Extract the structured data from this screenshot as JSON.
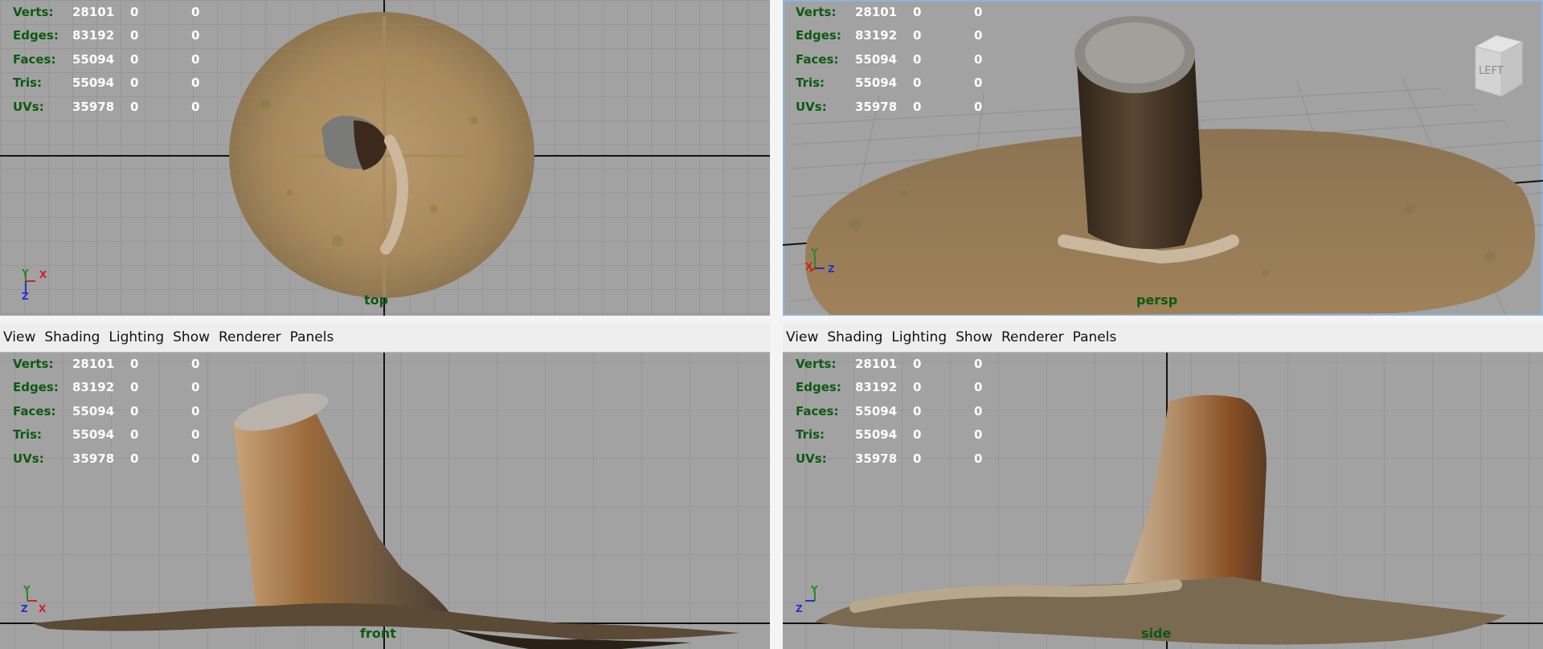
{
  "hud": [
    {
      "label": "Verts:",
      "v1": "28101",
      "v2": "0",
      "v3": "0"
    },
    {
      "label": "Edges:",
      "v1": "83192",
      "v2": "0",
      "v3": "0"
    },
    {
      "label": "Faces:",
      "v1": "55094",
      "v2": "0",
      "v3": "0"
    },
    {
      "label": "Tris:",
      "v1": "55094",
      "v2": "0",
      "v3": "0"
    },
    {
      "label": "UVs:",
      "v1": "35978",
      "v2": "0",
      "v3": "0"
    }
  ],
  "menu": [
    "View",
    "Shading",
    "Lighting",
    "Show",
    "Renderer",
    "Panels"
  ],
  "viewports": {
    "top": {
      "name": "top",
      "axes": [
        "Y",
        "X",
        "Z"
      ]
    },
    "persp": {
      "name": "persp",
      "axes": [
        "Y",
        "X",
        "Z"
      ]
    },
    "front": {
      "name": "front",
      "axes": [
        "Y",
        "Z",
        "X"
      ]
    },
    "side": {
      "name": "side",
      "axes": [
        "Y",
        "Z"
      ]
    }
  },
  "viewcube": {
    "label": "LEFT"
  },
  "colors": {
    "viewport_bg": "#a2a2a2",
    "hud_label": "#0c5a12",
    "hud_value": "#ffffff",
    "menu_bg": "#eeeeee"
  }
}
